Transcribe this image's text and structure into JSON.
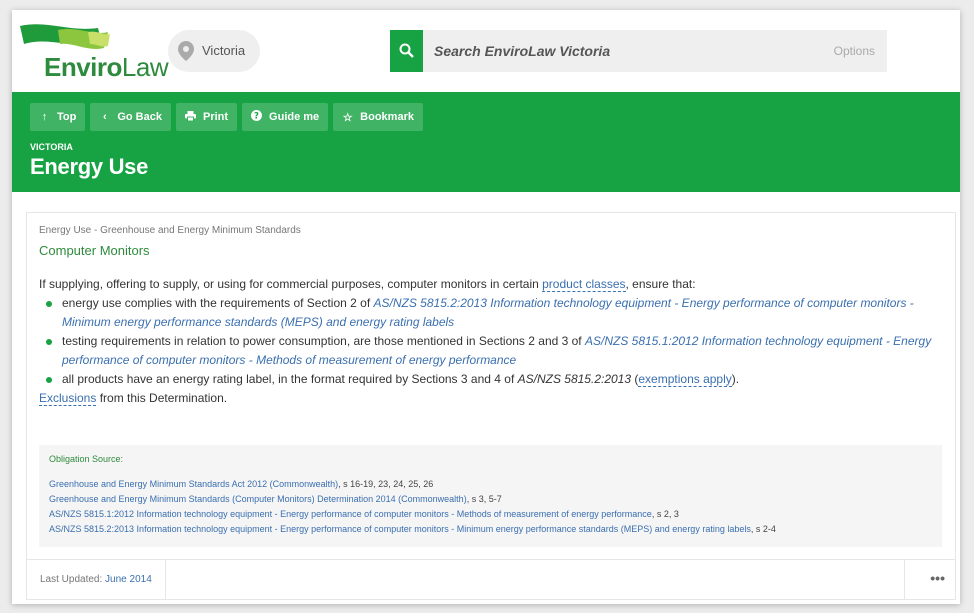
{
  "header": {
    "logo_enviro": "Enviro",
    "logo_law": "Law",
    "location": "Victoria",
    "search_placeholder": "Search EnviroLaw Victoria",
    "search_options": "Options"
  },
  "toolbar": {
    "top": "Top",
    "go_back": "Go Back",
    "print": "Print",
    "guide_me": "Guide me",
    "bookmark": "Bookmark"
  },
  "page": {
    "state": "Victoria",
    "title": "Energy Use"
  },
  "content": {
    "breadcrumb": "Energy Use - Greenhouse and Energy Minimum Standards",
    "heading": "Computer Monitors",
    "intro_before": "If supplying, offering to supply, or using for commercial purposes, computer monitors in certain ",
    "intro_link": "product classes",
    "intro_after": ", ensure that:",
    "item1_text": "energy use complies with the requirements of Section 2 of ",
    "item1_link": "AS/NZS 5815.2:2013 Information technology equipment - Energy performance of computer monitors - Minimum energy performance standards (MEPS) and energy rating labels",
    "item2_text": "testing requirements in relation to power consumption, are those mentioned in Sections 2 and 3 of ",
    "item2_link": "AS/NZS 5815.1:2012 Information technology equipment - Energy performance of computer monitors - Methods of measurement of energy performance",
    "item3_text": "all products have an energy rating label, in the format required by Sections 3 and 4 of ",
    "item3_ital": "AS/NZS 5815.2:2013",
    "item3_open": " (",
    "item3_link": "exemptions apply",
    "item3_close": ").",
    "exclusions_link": "Exclusions",
    "exclusions_text": " from this Determination."
  },
  "source": {
    "title": "Obligation Source:",
    "lines": [
      {
        "link": "Greenhouse and Energy Minimum Standards Act 2012 (Commonwealth)",
        "suffix": ", s 16-19, 23, 24, 25, 26"
      },
      {
        "link": "Greenhouse and Energy Minimum Standards (Computer Monitors) Determination 2014 (Commonwealth)",
        "suffix": ", s 3, 5-7"
      },
      {
        "link": "AS/NZS 5815.1:2012 Information technology equipment - Energy performance of computer monitors - Methods of measurement of energy performance",
        "suffix": ", s 2, 3"
      },
      {
        "link": "AS/NZS 5815.2:2013 Information technology equipment - Energy performance of computer monitors - Minimum energy performance standards (MEPS) and energy rating labels",
        "suffix": ", s 2-4"
      }
    ]
  },
  "footer": {
    "last_updated_label": "Last Updated:",
    "last_updated_value": "June 2014",
    "more": "•••"
  },
  "colors": {
    "brand_green": "#17a344",
    "link_blue": "#3a6fb0"
  }
}
